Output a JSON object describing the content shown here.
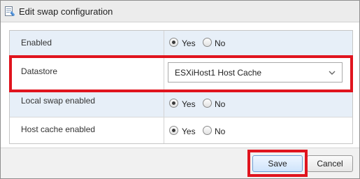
{
  "dialog": {
    "title": "Edit swap configuration",
    "title_icon": "swap-config-icon"
  },
  "rows": [
    {
      "label": "Enabled",
      "type": "radio",
      "options": [
        "Yes",
        "No"
      ],
      "selected": "Yes"
    },
    {
      "label": "Datastore",
      "type": "select",
      "value": "ESXiHost1 Host Cache"
    },
    {
      "label": "Local swap enabled",
      "type": "radio",
      "options": [
        "Yes",
        "No"
      ],
      "selected": "Yes"
    },
    {
      "label": "Host cache enabled",
      "type": "radio",
      "options": [
        "Yes",
        "No"
      ],
      "selected": "Yes"
    }
  ],
  "footer": {
    "save_label": "Save",
    "cancel_label": "Cancel"
  },
  "colors": {
    "highlight": "#e0141e",
    "row_alt": "#e7eff8"
  }
}
